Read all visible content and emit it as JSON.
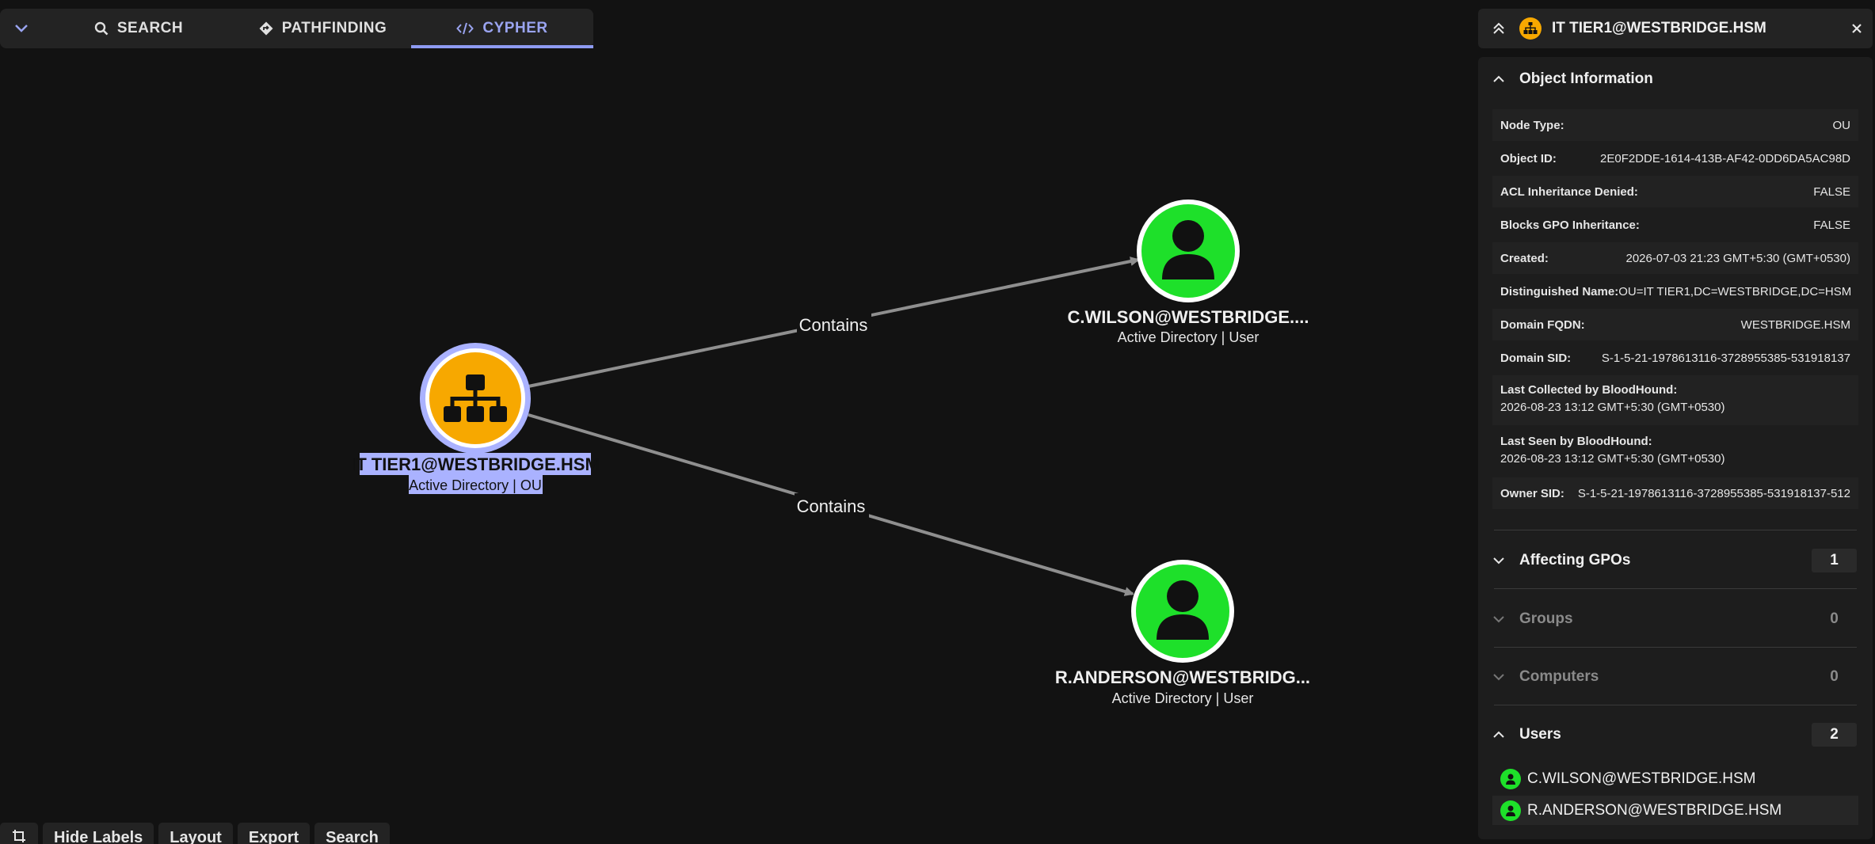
{
  "tabs": {
    "search": "SEARCH",
    "pathfinding": "PATHFINDING",
    "cypher": "CYPHER"
  },
  "graph": {
    "nodes": [
      {
        "id": "ou",
        "label": "IT TIER1@WESTBRIDGE.HSM",
        "sub": "Active Directory | OU",
        "kind": "ou",
        "color": "#f7a800"
      },
      {
        "id": "cw",
        "label": "C.WILSON@WESTBRIDGE....",
        "sub": "Active Directory | User",
        "kind": "user",
        "color": "#1ee02a"
      },
      {
        "id": "ra",
        "label": "R.ANDERSON@WESTBRIDG...",
        "sub": "Active Directory | User",
        "kind": "user",
        "color": "#1ee02a"
      }
    ],
    "edges": [
      {
        "label": "Contains"
      },
      {
        "label": "Contains"
      }
    ]
  },
  "toolbar": {
    "hide_labels": "Hide Labels",
    "layout": "Layout",
    "export": "Export",
    "search": "Search"
  },
  "panel": {
    "title": "IT TIER1@WESTBRIDGE.HSM",
    "object_info": {
      "heading": "Object Information",
      "props": [
        {
          "key": "Node Type:",
          "value": "OU"
        },
        {
          "key": "Object ID:",
          "value": "2E0F2DDE-1614-413B-AF42-0DD6DA5AC98D"
        },
        {
          "key": "ACL Inheritance Denied:",
          "value": "FALSE"
        },
        {
          "key": "Blocks GPO Inheritance:",
          "value": "FALSE"
        },
        {
          "key": "Created:",
          "value": "2026-07-03 21:23 GMT+5:30 (GMT+0530)"
        },
        {
          "key": "Distinguished Name:",
          "value": "OU=IT TIER1,DC=WESTBRIDGE,DC=HSM"
        },
        {
          "key": "Domain FQDN:",
          "value": "WESTBRIDGE.HSM"
        },
        {
          "key": "Domain SID:",
          "value": "S-1-5-21-1978613116-3728955385-531918137"
        },
        {
          "key": "Last Collected by BloodHound:",
          "value": "2026-08-23 13:12 GMT+5:30 (GMT+0530)"
        },
        {
          "key": "Last Seen by BloodHound:",
          "value": "2026-08-23 13:12 GMT+5:30 (GMT+0530)"
        },
        {
          "key": "Owner SID:",
          "value": "S-1-5-21-1978613116-3728955385-531918137-512"
        }
      ]
    },
    "sections": [
      {
        "title": "Affecting GPOs",
        "count": "1"
      },
      {
        "title": "Groups",
        "count": "0"
      },
      {
        "title": "Computers",
        "count": "0"
      },
      {
        "title": "Users",
        "count": "2"
      }
    ],
    "users": [
      "C.WILSON@WESTBRIDGE.HSM",
      "R.ANDERSON@WESTBRIDGE.HSM"
    ]
  },
  "colors": {
    "accent": "#8e9bf2",
    "ou": "#f7a800",
    "user": "#1ee02a",
    "selection": "#aab2ff"
  }
}
